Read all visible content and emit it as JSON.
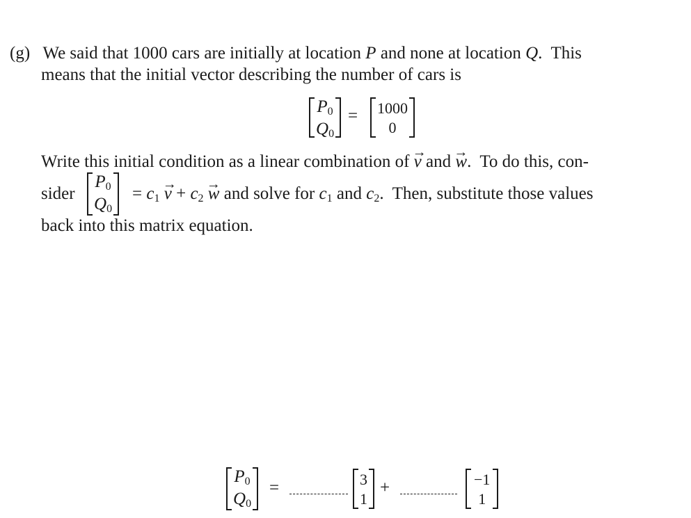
{
  "problem": {
    "label": "(g)",
    "paragraph1": {
      "line1_a": "We said that 1000 cars are initially at location ",
      "var_P": "P",
      "line1_b": " and none at location ",
      "var_Q": "Q",
      "line1_c": ".  This",
      "line2": "means that the initial vector describing the number of cars is"
    },
    "initial_vector_equation": {
      "lhs": [
        "P",
        "Q"
      ],
      "lhs_subscript": "0",
      "equals": "=",
      "rhs": [
        "1000",
        "0"
      ]
    },
    "paragraph2": {
      "line1_a": "Write this initial condition as a linear combination of ",
      "vec_v": "v",
      "line1_and": " and ",
      "vec_w": "w",
      "line1_b": ".  To do this, con-",
      "line2_a": "sider",
      "equals": "=",
      "c1": "c",
      "c1_sub": "1",
      "plus": "+",
      "c2": "c",
      "c2_sub": "2",
      "line2_b": " and solve for ",
      "line2_and": " and ",
      "line2_c": ".  Then, substitute those values",
      "line3": "back into this matrix equation."
    },
    "answer_equation": {
      "lhs": [
        "P",
        "Q"
      ],
      "lhs_subscript": "0",
      "equals": "=",
      "plus": "+",
      "vector_v": [
        "3",
        "1"
      ],
      "vector_w": [
        "−1",
        "1"
      ],
      "blank1_value": "",
      "blank2_value": ""
    },
    "arrow_glyph": "⃗"
  }
}
